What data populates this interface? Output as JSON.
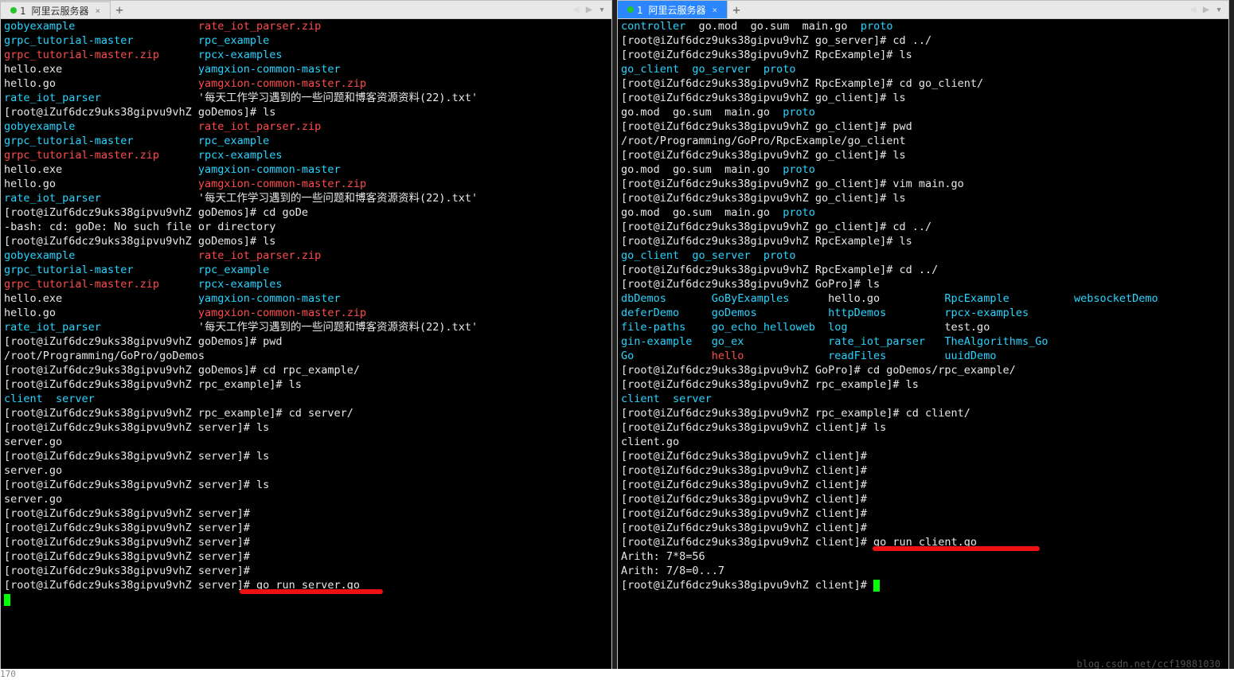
{
  "tabs": {
    "left": {
      "index": "1",
      "title": "阿里云服务器",
      "close": "×"
    },
    "right": {
      "index": "1",
      "title": "阿里云服务器",
      "close": "×"
    },
    "add": "+",
    "nav_left": "◀",
    "nav_right": "▶",
    "menu": "▾"
  },
  "prompt_host": "root@iZuf6dcz9uks38gipvu9vhZ",
  "left": {
    "ls1": [
      [
        "gobyexample",
        "rate_iot_parser.zip",
        "cyan",
        "red"
      ],
      [
        "grpc_tutorial-master",
        "rpc_example",
        "cyan",
        "cyan"
      ],
      [
        "grpc_tutorial-master.zip",
        "rpcx-examples",
        "red",
        "cyan"
      ],
      [
        "hello.exe",
        "yamgxion-common-master",
        "white",
        "cyan"
      ],
      [
        "hello.go",
        "yamgxion-common-master.zip",
        "white",
        "red"
      ],
      [
        "rate_iot_parser",
        "'每天工作学习遇到的一些问题和博客资源资料(22).txt'",
        "cyan",
        "white"
      ]
    ],
    "lines": [
      {
        "prompt": "goDemos",
        "cmd": "ls"
      },
      {
        "prompt": "goDemos",
        "cmd": "cd goDe"
      },
      {
        "plain": "-bash: cd: goDe: No such file or directory"
      },
      {
        "prompt": "goDemos",
        "cmd": "ls"
      },
      {
        "prompt": "goDemos",
        "cmd": "pwd"
      },
      {
        "plain": "/root/Programming/GoPro/goDemos"
      },
      {
        "prompt": "goDemos",
        "cmd": "cd rpc_example/"
      },
      {
        "prompt": "rpc_example",
        "cmd": "ls"
      },
      {
        "plain_cyan": "client  server"
      },
      {
        "prompt": "rpc_example",
        "cmd": "cd server/"
      },
      {
        "prompt": "server",
        "cmd": "ls"
      },
      {
        "plain": "server.go"
      },
      {
        "prompt": "server",
        "cmd": "ls"
      },
      {
        "plain": "server.go"
      },
      {
        "prompt": "server",
        "cmd": "ls"
      },
      {
        "plain": "server.go"
      },
      {
        "prompt": "server",
        "cmd": ""
      },
      {
        "prompt": "server",
        "cmd": ""
      },
      {
        "prompt": "server",
        "cmd": ""
      },
      {
        "prompt": "server",
        "cmd": ""
      },
      {
        "prompt": "server",
        "cmd": ""
      },
      {
        "prompt": "server",
        "cmd": "go run server.go",
        "annot": true
      },
      {
        "cursor": true
      }
    ]
  },
  "right": {
    "lines": [
      {
        "pieces": [
          [
            "controller",
            "cyan"
          ],
          [
            "  ",
            " "
          ],
          [
            "go.mod",
            "white"
          ],
          [
            "  ",
            " "
          ],
          [
            "go.sum",
            "white"
          ],
          [
            "  ",
            " "
          ],
          [
            "main.go",
            "white"
          ],
          [
            "  ",
            " "
          ],
          [
            "proto",
            "cyan"
          ]
        ]
      },
      {
        "prompt": "go_server",
        "cmd": "cd ../"
      },
      {
        "prompt": "RpcExample",
        "cmd": "ls"
      },
      {
        "pieces": [
          [
            "go_client",
            "cyan"
          ],
          [
            "  ",
            " "
          ],
          [
            "go_server",
            "cyan"
          ],
          [
            "  ",
            " "
          ],
          [
            "proto",
            "cyan"
          ]
        ]
      },
      {
        "prompt": "RpcExample",
        "cmd": "cd go_client/"
      },
      {
        "prompt": "go_client",
        "cmd": "ls"
      },
      {
        "pieces": [
          [
            "go.mod",
            "white"
          ],
          [
            "  ",
            " "
          ],
          [
            "go.sum",
            "white"
          ],
          [
            "  ",
            " "
          ],
          [
            "main.go",
            "white"
          ],
          [
            "  ",
            " "
          ],
          [
            "proto",
            "cyan"
          ]
        ]
      },
      {
        "prompt": "go_client",
        "cmd": "pwd"
      },
      {
        "plain": "/root/Programming/GoPro/RpcExample/go_client"
      },
      {
        "prompt": "go_client",
        "cmd": "ls"
      },
      {
        "pieces": [
          [
            "go.mod",
            "white"
          ],
          [
            "  ",
            " "
          ],
          [
            "go.sum",
            "white"
          ],
          [
            "  ",
            " "
          ],
          [
            "main.go",
            "white"
          ],
          [
            "  ",
            " "
          ],
          [
            "proto",
            "cyan"
          ]
        ]
      },
      {
        "prompt": "go_client",
        "cmd": "vim main.go"
      },
      {
        "prompt": "go_client",
        "cmd": "ls"
      },
      {
        "pieces": [
          [
            "go.mod",
            "white"
          ],
          [
            "  ",
            " "
          ],
          [
            "go.sum",
            "white"
          ],
          [
            "  ",
            " "
          ],
          [
            "main.go",
            "white"
          ],
          [
            "  ",
            " "
          ],
          [
            "proto",
            "cyan"
          ]
        ]
      },
      {
        "prompt": "go_client",
        "cmd": "cd ../"
      },
      {
        "prompt": "RpcExample",
        "cmd": "ls"
      },
      {
        "pieces": [
          [
            "go_client",
            "cyan"
          ],
          [
            "  ",
            " "
          ],
          [
            "go_server",
            "cyan"
          ],
          [
            "  ",
            " "
          ],
          [
            "proto",
            "cyan"
          ]
        ]
      },
      {
        "prompt": "RpcExample",
        "cmd": "cd ../"
      },
      {
        "prompt": "GoPro",
        "cmd": "ls"
      },
      {
        "cols": [
          [
            "dbDemos",
            "GoByExamples",
            "hello.go",
            "RpcExample",
            "websocketDemo"
          ],
          [
            "deferDemo",
            "goDemos",
            "httpDemos",
            "rpcx-examples",
            ""
          ],
          [
            "file-paths",
            "go_echo_helloweb",
            "log",
            "test.go",
            ""
          ],
          [
            "gin-example",
            "go_ex",
            "rate_iot_parser",
            "TheAlgorithms_Go",
            ""
          ],
          [
            "Go",
            "hello",
            "readFiles",
            "uuidDemo",
            ""
          ]
        ],
        "colcls": [
          [
            "cyan",
            "cyan",
            "white",
            "cyan",
            "cyan"
          ],
          [
            "cyan",
            "cyan",
            "cyan",
            "cyan",
            ""
          ],
          [
            "cyan",
            "cyan",
            "cyan",
            "white",
            ""
          ],
          [
            "cyan",
            "cyan",
            "cyan",
            "cyan",
            ""
          ],
          [
            "cyan",
            "red",
            "cyan",
            "cyan",
            ""
          ]
        ]
      },
      {
        "prompt": "GoPro",
        "cmd": "cd goDemos/rpc_example/"
      },
      {
        "prompt": "rpc_example",
        "cmd": "ls"
      },
      {
        "pieces": [
          [
            "client",
            "cyan"
          ],
          [
            "  ",
            " "
          ],
          [
            "server",
            "cyan"
          ]
        ]
      },
      {
        "prompt": "rpc_example",
        "cmd": "cd client/"
      },
      {
        "prompt": "client",
        "cmd": "ls"
      },
      {
        "plain": "client.go"
      },
      {
        "prompt": "client",
        "cmd": ""
      },
      {
        "prompt": "client",
        "cmd": ""
      },
      {
        "prompt": "client",
        "cmd": ""
      },
      {
        "prompt": "client",
        "cmd": ""
      },
      {
        "prompt": "client",
        "cmd": ""
      },
      {
        "prompt": "client",
        "cmd": ""
      },
      {
        "prompt": "client",
        "cmd": "go run client.go",
        "annot": true
      },
      {
        "plain": "Arith: 7*8=56"
      },
      {
        "plain": "Arith: 7/8=0...7"
      },
      {
        "prompt": "client",
        "cmd": "",
        "cursor": true
      }
    ]
  },
  "watermark": "blog.csdn.net/ccf19881030",
  "footer": "170"
}
